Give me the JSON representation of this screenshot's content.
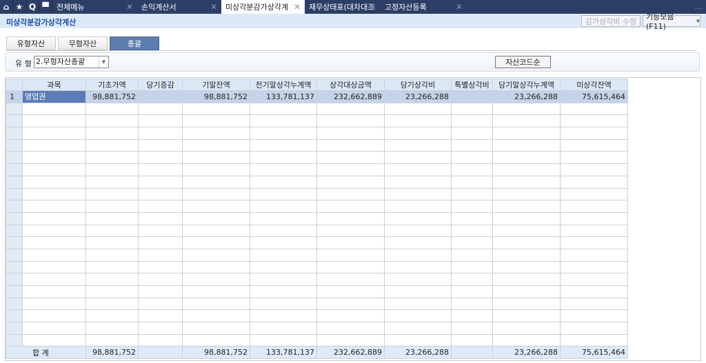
{
  "tabbar": {
    "icons": [
      "home-icon",
      "star-icon",
      "search-icon",
      "menu-grid-icon"
    ],
    "tabs": [
      {
        "label": "전체메뉴",
        "active": false
      },
      {
        "label": "손익계산서",
        "active": false
      },
      {
        "label": "미상각분감가상각계",
        "active": true
      },
      {
        "label": "재무상태표(대차대조",
        "active": false
      },
      {
        "label": "고정자산등록",
        "active": false
      }
    ],
    "more": "..."
  },
  "header": {
    "title": "미상각분감가상각계산",
    "edit_button": "감가상각비 수정",
    "func_button": "기능모음(F11)"
  },
  "subtabs": [
    {
      "label": "유형자산"
    },
    {
      "label": "무형자산"
    },
    {
      "label": "총괄",
      "active": true
    }
  ],
  "filter": {
    "label": "유 형",
    "value": "2.무형자산총괄",
    "sort_button": "자산코드순"
  },
  "grid": {
    "columns": [
      "",
      "과목",
      "기초가액",
      "당기증감",
      "기말잔액",
      "전기말상각누계액",
      "상각대상금액",
      "당기상각비",
      "특별상각비",
      "당기말상각누계액",
      "미상각잔액"
    ],
    "rows": [
      [
        "1",
        "영업권",
        "98,881,752",
        "",
        "98,881,752",
        "133,781,137",
        "232,662,889",
        "23,266,288",
        "",
        "23,266,288",
        "75,615,464"
      ]
    ],
    "total": [
      "합   계",
      "98,881,752",
      "",
      "98,881,752",
      "133,781,137",
      "232,662,889",
      "23,266,288",
      "",
      "23,266,288",
      "75,615,464"
    ]
  }
}
